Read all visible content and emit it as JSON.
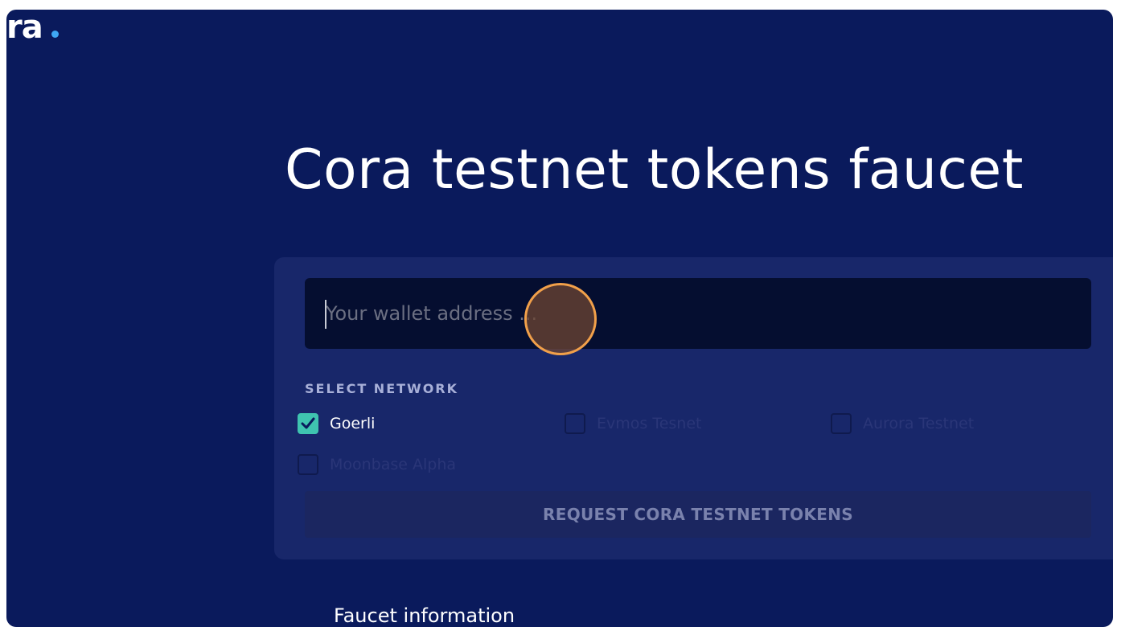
{
  "brand": {
    "logo_text": "ra",
    "dot_color": "#3fa8f4"
  },
  "page": {
    "title": "Cora testnet tokens faucet"
  },
  "form": {
    "wallet_placeholder": "Your wallet address ...",
    "network_section_label": "SELECT NETWORK",
    "networks": [
      {
        "label": "Goerli",
        "checked": true
      },
      {
        "label": "Evmos Tesnet",
        "checked": false
      },
      {
        "label": "Aurora Testnet",
        "checked": false
      },
      {
        "label": "Moonbase Alpha",
        "checked": false
      }
    ],
    "request_button_label": "REQUEST CORA TESTNET TOKENS"
  },
  "footer": {
    "faucet_info_label": "Faucet information"
  },
  "colors": {
    "background": "#0a1a5c",
    "card": "#18276a",
    "input": "#050e30",
    "checkbox_checked": "#3fc4b0",
    "cursor_ring": "#f1a04a"
  }
}
